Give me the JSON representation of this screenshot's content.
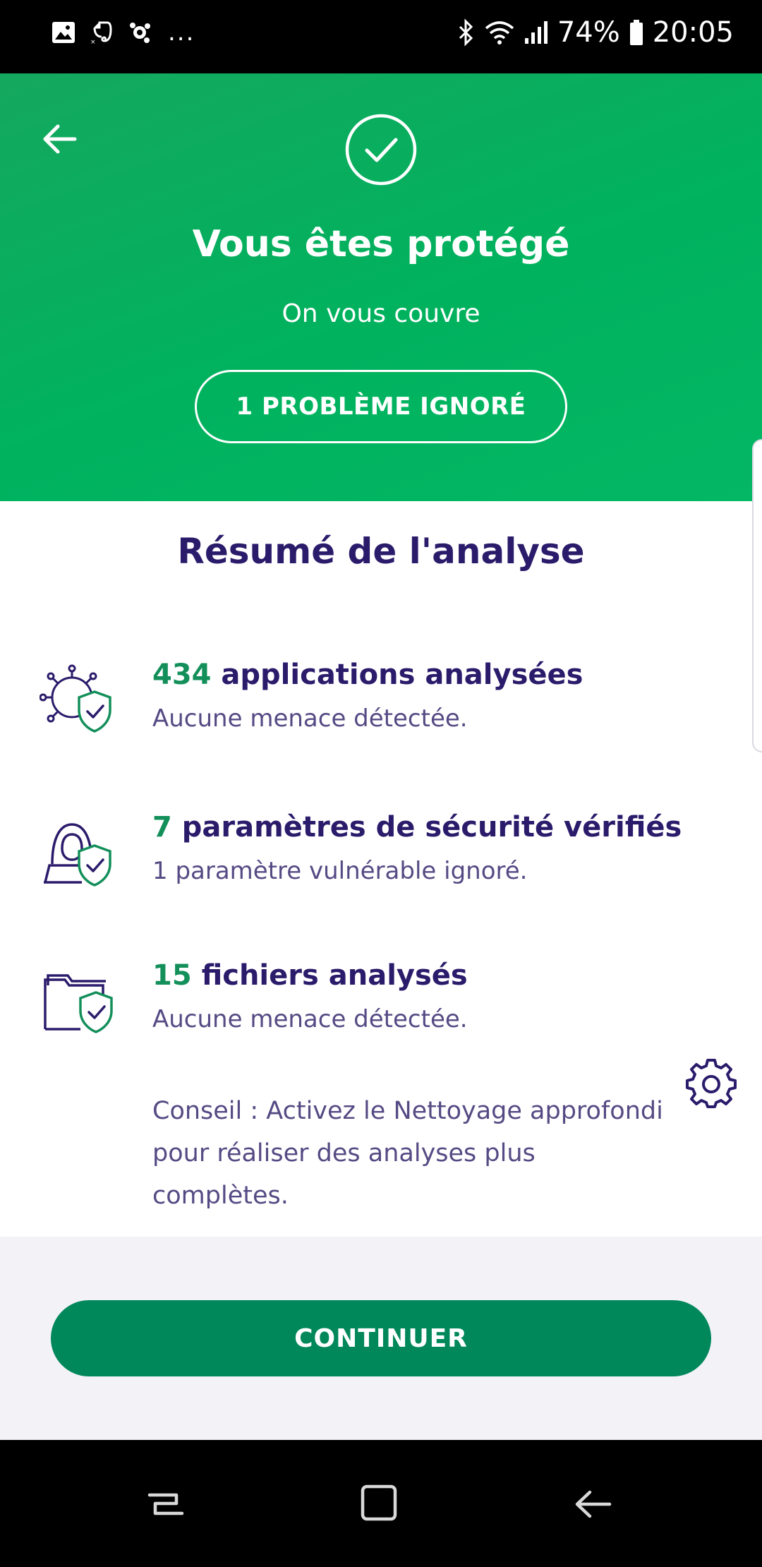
{
  "status_bar": {
    "icons_left": [
      "gallery-icon",
      "evernote-icon",
      "avast-icon"
    ],
    "more": "...",
    "icons_right": [
      "bluetooth-icon",
      "wifi-icon",
      "signal-icon",
      "battery-icon"
    ],
    "battery": "74%",
    "time": "20:05"
  },
  "header": {
    "title": "Vous êtes protégé",
    "subtitle": "On vous couvre",
    "ignored_button": "1 PROBLÈME IGNORÉ",
    "back_icon": "arrow-left-icon",
    "status_icon": "check-circle-icon",
    "background": "#00b25e"
  },
  "summary": {
    "title": "Résumé de l'analyse",
    "items": [
      {
        "count": "434",
        "label": " applications analysées",
        "detail": "Aucune menace détectée.",
        "icon": "virus-shield-icon"
      },
      {
        "count": "7",
        "label": " paramètres de sécurité vérifiés",
        "detail": "1 paramètre vulnérable ignoré.",
        "icon": "hacker-shield-icon"
      },
      {
        "count": "15",
        "label": " fichiers analysés",
        "detail": "Aucune menace détectée.",
        "icon": "folder-shield-icon"
      }
    ],
    "tip": "Conseil : Activez le Nettoyage approfondi pour réaliser des analyses plus complètes.",
    "settings_icon": "gear-icon"
  },
  "footer": {
    "continue_button": "CONTINUER",
    "button_color": "#00875a"
  },
  "nav_bar": {
    "buttons": [
      "recent-apps-icon",
      "home-icon",
      "back-icon"
    ]
  },
  "colors": {
    "title": "#2b1b6b",
    "accent_number": "#138f5a",
    "body_text": "#564a84"
  }
}
